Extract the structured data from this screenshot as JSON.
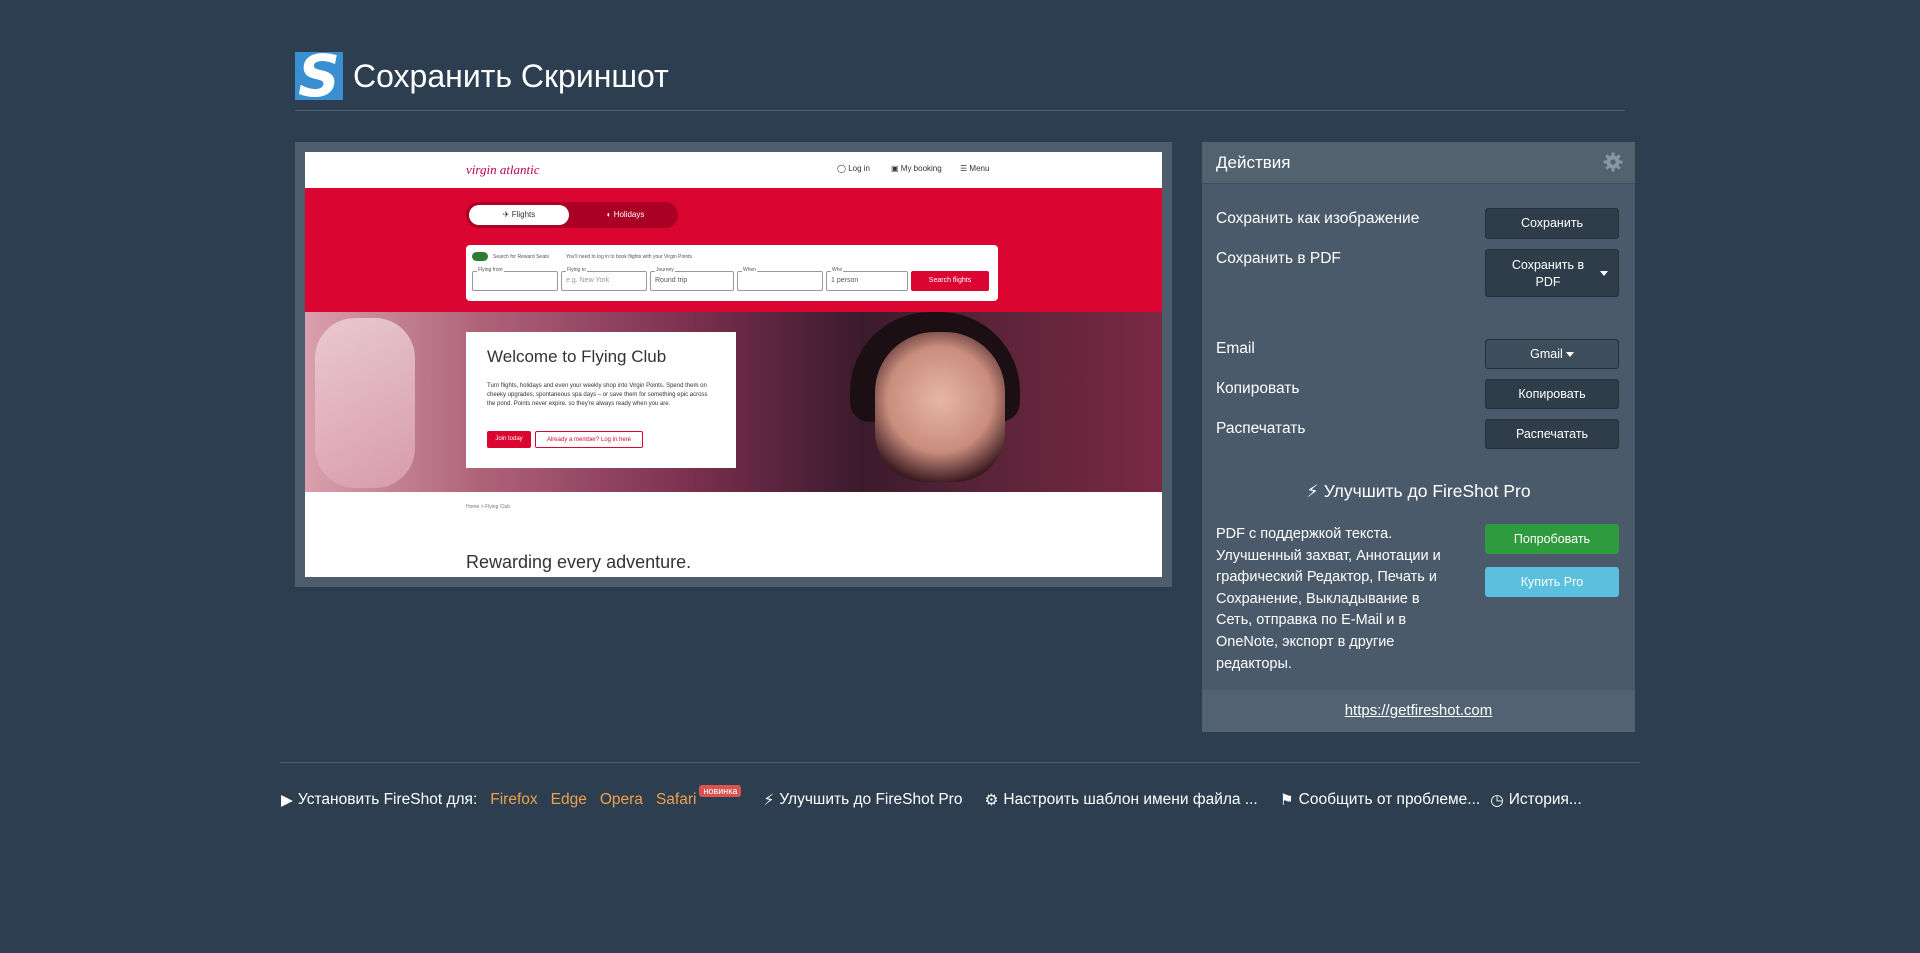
{
  "header": {
    "title": "Сохранить Скриншот",
    "logo_letter": "S"
  },
  "preview": {
    "site_logo": "virgin atlantic",
    "nav": {
      "login": "Log in",
      "booking": "My booking",
      "menu": "Menu"
    },
    "tabs": {
      "flights": "Flights",
      "holidays": "Holidays"
    },
    "form": {
      "reward_label": "Search for Reward Seats",
      "reward_note": "You'll need to log in to book flights with your Virgin Points",
      "flying_from": "Flying from",
      "flying_to": "Flying to",
      "flying_to_placeholder": "e.g. New York",
      "journey": "Journey",
      "journey_value": "Round trip",
      "when": "When",
      "who": "Who",
      "who_value": "1 person",
      "search": "Search flights"
    },
    "card": {
      "title": "Welcome to Flying Club",
      "body": "Turn flights, holidays and even your weekly shop into Virgin Points. Spend them on cheeky upgrades, spontaneous spa days – or save them for something epic across the pond. Points never expire, so they're always ready when you are.",
      "join": "Join today",
      "member": "Already a member? Log in here"
    },
    "breadcrumb": "Home > Flying Club",
    "section_title": "Rewarding every adventure."
  },
  "actions": {
    "title": "Действия",
    "rows": [
      {
        "label": "Сохранить как изображение",
        "button": "Сохранить"
      },
      {
        "label": "Сохранить в PDF",
        "button": "Сохранить в PDF"
      },
      {
        "label": "Email",
        "button": "Gmail"
      },
      {
        "label": "Копировать",
        "button": "Копировать"
      },
      {
        "label": "Распечатать",
        "button": "Распечатать"
      }
    ],
    "upgrade": "Улучшить до FireShot Pro",
    "pro_text": "PDF с поддержкой текста. Улучшенный захват, Аннотации и графический Редактор, Печать и Сохранение, Выкладывание в Сеть, отправка по E-Mail и в OneNote, экспорт в другие редакторы.",
    "try_button": "Попробовать",
    "buy_button": "Купить Pro",
    "link": "https://getfireshot.com"
  },
  "footer": {
    "install_label": "Установить FireShot для:",
    "browsers": [
      "Firefox",
      "Edge",
      "Opera",
      "Safari"
    ],
    "new_badge": "новинка",
    "upgrade": "Улучшить до FireShot Pro",
    "template": "Настроить шаблон имени файла ...",
    "report": "Сообщить от проблеме...",
    "history": "История..."
  },
  "colors": {
    "background": "#2c3e50",
    "panel": "#4a5a6a",
    "accent_orange": "#f0a04b",
    "green": "#2e9b3e",
    "blue": "#5bc0de",
    "virgin_red": "#da0530"
  }
}
